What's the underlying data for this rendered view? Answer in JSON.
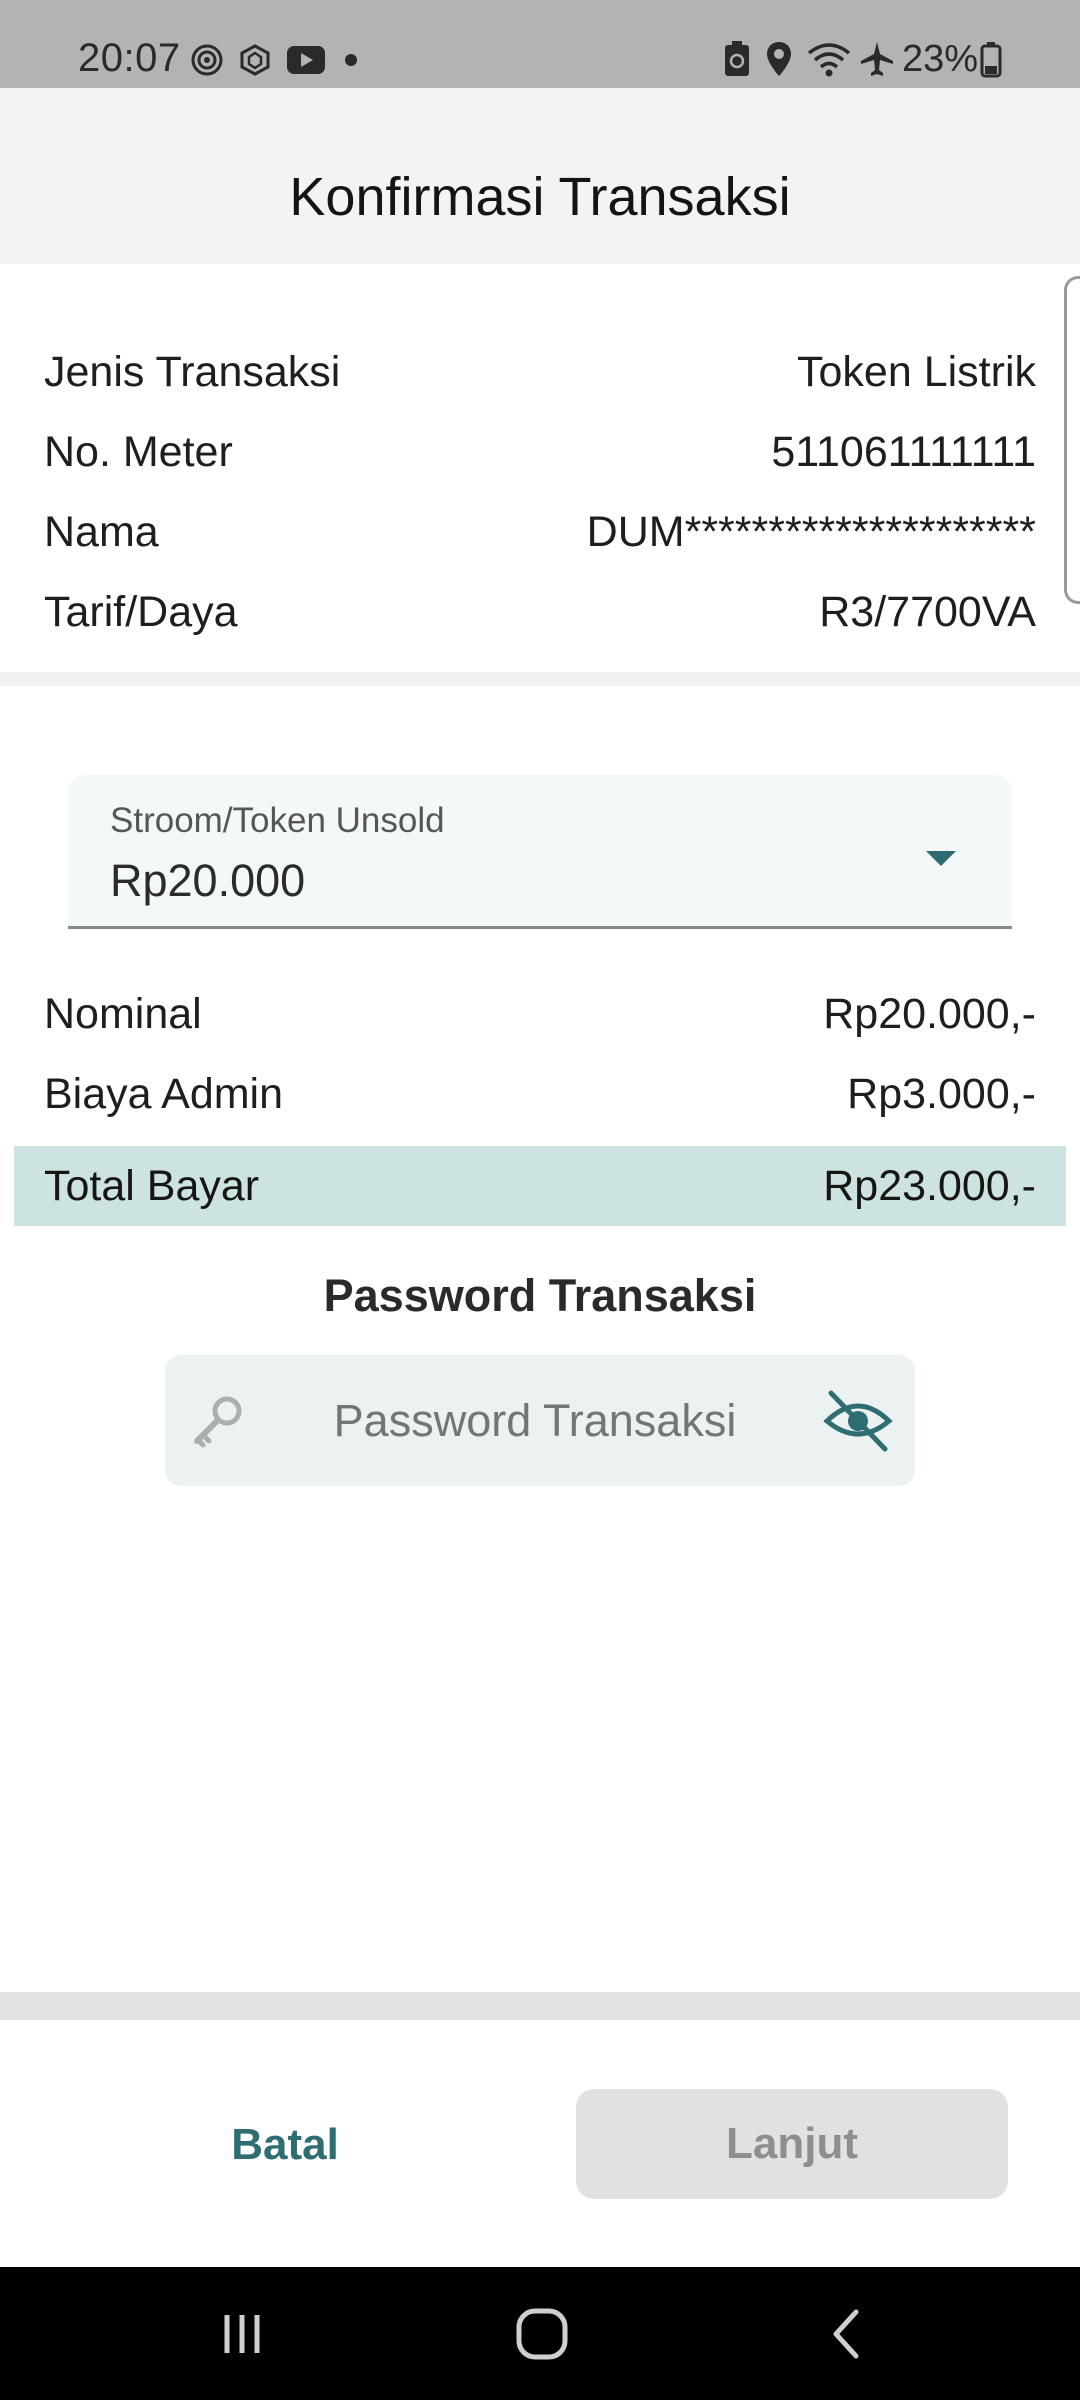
{
  "status_bar": {
    "time": "20:07",
    "notification_icons": [
      "bullseye-icon",
      "aperture-icon",
      "youtube-icon",
      "dot-icon"
    ],
    "system_icons": [
      "battery-saver-icon",
      "location-icon",
      "wifi-icon",
      "airplane-icon"
    ],
    "battery": "23%"
  },
  "header": {
    "title": "Konfirmasi Transaksi"
  },
  "details": [
    {
      "label": "Jenis Transaksi",
      "value": "Token Listrik"
    },
    {
      "label": "No. Meter",
      "value": "511061111111"
    },
    {
      "label": "Nama",
      "value": "DUM*********************"
    },
    {
      "label": "Tarif/Daya",
      "value": "R3/7700VA"
    }
  ],
  "dropdown": {
    "label": "Stroom/Token Unsold",
    "value": "Rp20.000"
  },
  "costs": [
    {
      "label": "Nominal",
      "value": "Rp20.000,-"
    },
    {
      "label": "Biaya Admin",
      "value": "Rp3.000,-"
    }
  ],
  "total": {
    "label": "Total Bayar",
    "value": "Rp23.000,-"
  },
  "password": {
    "title": "Password Transaksi",
    "placeholder": "Password Transaksi",
    "value": ""
  },
  "actions": {
    "cancel_label": "Batal",
    "continue_label": "Lanjut"
  },
  "colors": {
    "accent": "#2e6e73",
    "total_bg": "#cde3e1",
    "field_bg": "#ebf2f1",
    "disabled_button_bg": "#e1e1e1"
  }
}
